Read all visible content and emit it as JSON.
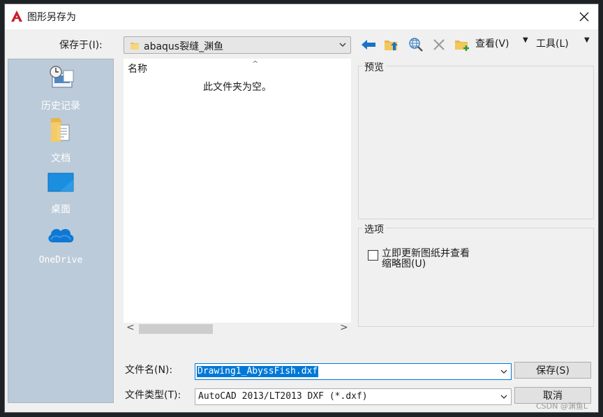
{
  "window": {
    "title": "图形另存为"
  },
  "toolbar": {
    "save_in_label": "保存于(I):",
    "save_in_value": "abaqus裂缝_渊鱼",
    "view_label": "查看(V)",
    "tools_label": "工具(L)"
  },
  "places": [
    {
      "label": "历史记录",
      "icon": "history-icon"
    },
    {
      "label": "文档",
      "icon": "documents-icon"
    },
    {
      "label": "桌面",
      "icon": "desktop-icon"
    },
    {
      "label": "OneDrive",
      "icon": "onedrive-icon"
    }
  ],
  "file_list": {
    "column_name": "名称",
    "empty_message": "此文件夹为空。"
  },
  "preview": {
    "title": "预览"
  },
  "options": {
    "title": "选项",
    "checkbox_line1": "立即更新图纸并查看",
    "checkbox_line2": "缩略图(U)",
    "checked": false
  },
  "filename": {
    "label": "文件名(N):",
    "value": "Drawing1_AbyssFish.dxf"
  },
  "filetype": {
    "label": "文件类型(T):",
    "value": "AutoCAD 2013/LT2013 DXF (*.dxf)"
  },
  "buttons": {
    "save": "保存(S)",
    "cancel": "取消"
  },
  "watermark": "CSDN @渊鱼L",
  "colors": {
    "accent": "#0078d7",
    "places_bg": "#bccbd9",
    "autocad_red": "#c8202b"
  }
}
